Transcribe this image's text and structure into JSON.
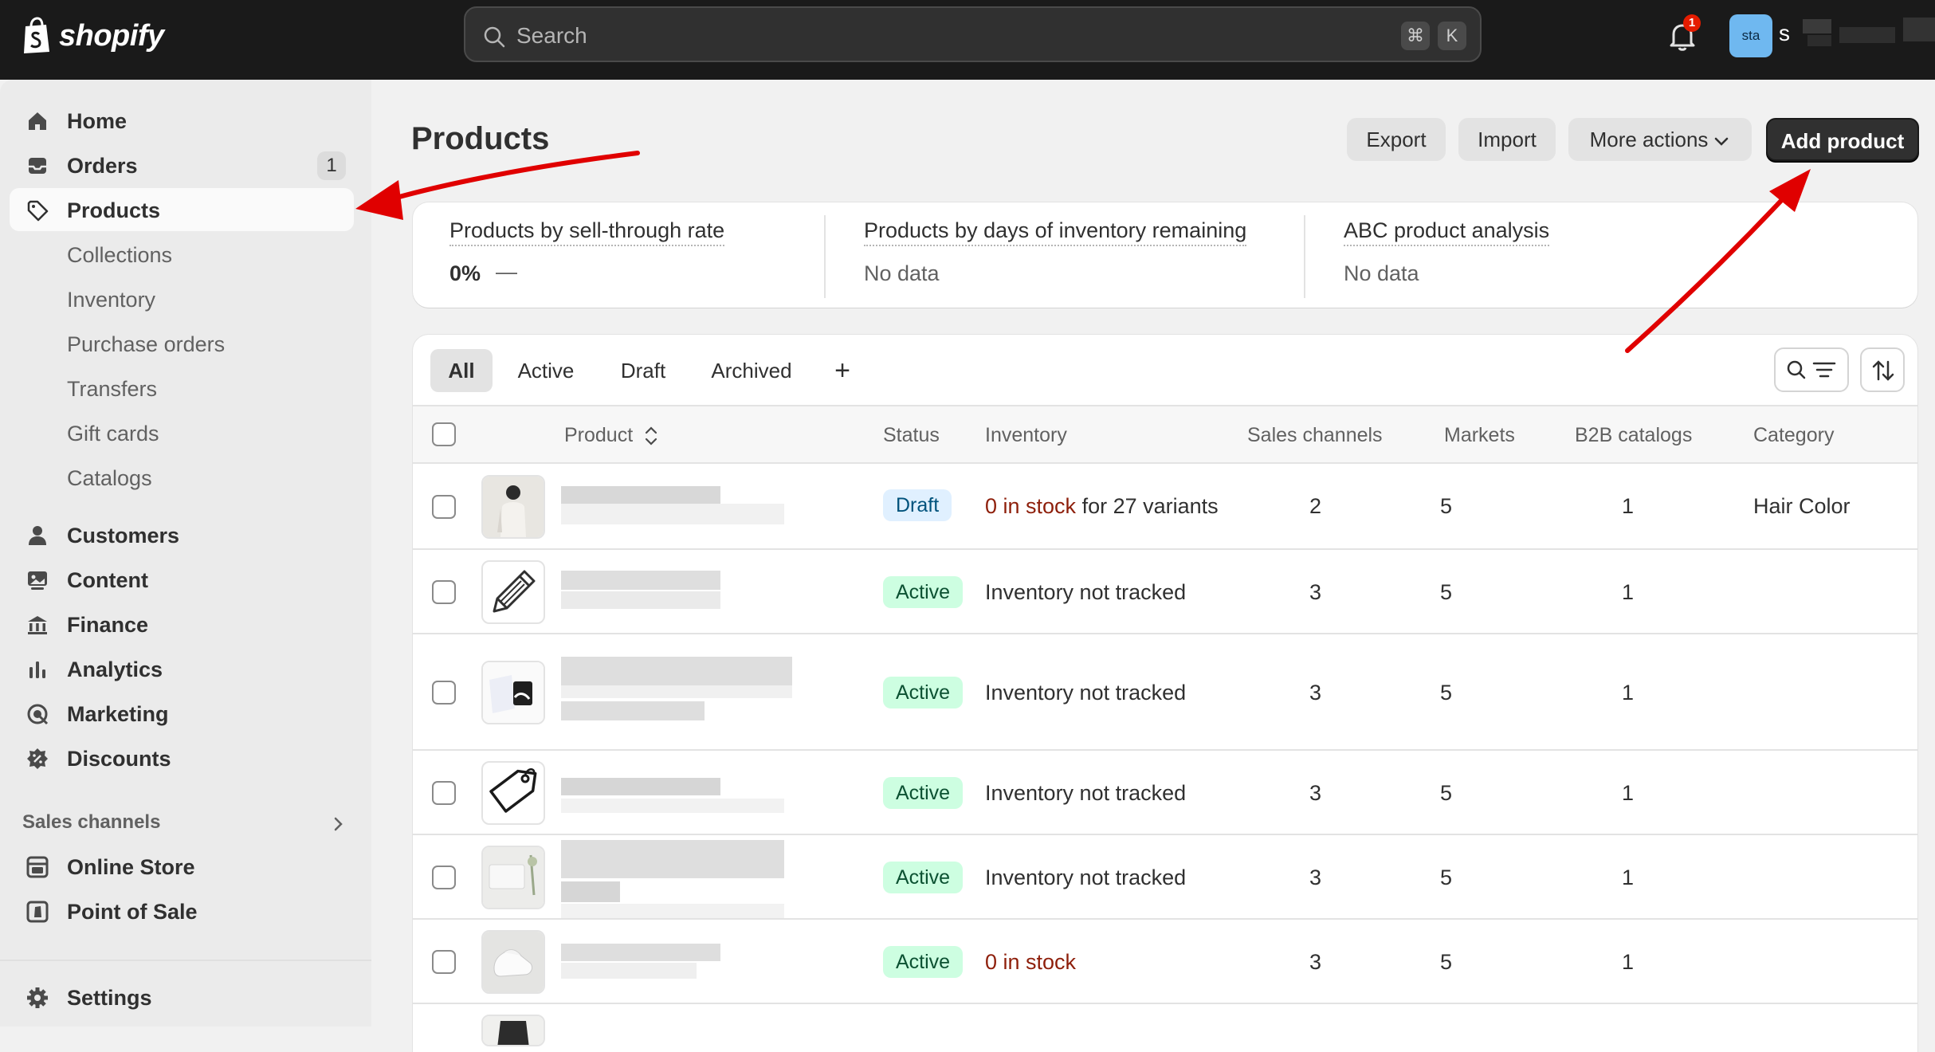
{
  "brand": {
    "name": "shopify",
    "color": "#1a1a1a",
    "accent": "#303030"
  },
  "search": {
    "placeholder": "Search",
    "shortcut_keys": [
      "⌘",
      "K"
    ]
  },
  "notifications": {
    "count": "1"
  },
  "account": {
    "avatar_initials": "sta",
    "store_name_visible": "s"
  },
  "sidebar": {
    "items": [
      {
        "label": "Home",
        "icon": "home-icon"
      },
      {
        "label": "Orders",
        "icon": "inbox-icon",
        "count": "1"
      },
      {
        "label": "Products",
        "icon": "tag-icon",
        "selected": true
      },
      {
        "label": "Collections"
      },
      {
        "label": "Inventory"
      },
      {
        "label": "Purchase orders"
      },
      {
        "label": "Transfers"
      },
      {
        "label": "Gift cards"
      },
      {
        "label": "Catalogs"
      },
      {
        "label": "Customers",
        "icon": "person-icon"
      },
      {
        "label": "Content",
        "icon": "image-icon"
      },
      {
        "label": "Finance",
        "icon": "bank-icon"
      },
      {
        "label": "Analytics",
        "icon": "bar-chart-icon"
      },
      {
        "label": "Marketing",
        "icon": "target-icon"
      },
      {
        "label": "Discounts",
        "icon": "discount-icon"
      }
    ],
    "sales_channels_title": "Sales channels",
    "channels": [
      {
        "label": "Online Store",
        "icon": "store-icon"
      },
      {
        "label": "Point of Sale",
        "icon": "pos-icon"
      }
    ],
    "settings_label": "Settings"
  },
  "page": {
    "title": "Products",
    "buttons": {
      "export": "Export",
      "import": "Import",
      "more_actions": "More actions",
      "add_product": "Add product"
    }
  },
  "metrics": [
    {
      "title": "Products by sell-through rate",
      "value": "0%",
      "trend": "—"
    },
    {
      "title": "Products by days of inventory remaining",
      "value": "No data"
    },
    {
      "title": "ABC product analysis",
      "value": "No data"
    }
  ],
  "tabs": [
    "All",
    "Active",
    "Draft",
    "Archived"
  ],
  "add_view_symbol": "+",
  "table": {
    "columns": [
      "Product",
      "Status",
      "Inventory",
      "Sales channels",
      "Markets",
      "B2B catalogs",
      "Category"
    ],
    "rows": [
      {
        "status": "Draft",
        "inventory_red": "0 in stock",
        "inventory_rest": " for 27 variants",
        "sales_channels": "2",
        "markets": "5",
        "b2b": "1",
        "category": "Hair Color"
      },
      {
        "status": "Active",
        "inventory_red": "",
        "inventory_rest": "Inventory not tracked",
        "sales_channels": "3",
        "markets": "5",
        "b2b": "1",
        "category": ""
      },
      {
        "status": "Active",
        "inventory_red": "",
        "inventory_rest": "Inventory not tracked",
        "sales_channels": "3",
        "markets": "5",
        "b2b": "1",
        "category": ""
      },
      {
        "status": "Active",
        "inventory_red": "",
        "inventory_rest": "Inventory not tracked",
        "sales_channels": "3",
        "markets": "5",
        "b2b": "1",
        "category": ""
      },
      {
        "status": "Active",
        "inventory_red": "",
        "inventory_rest": "Inventory not tracked",
        "sales_channels": "3",
        "markets": "5",
        "b2b": "1",
        "category": ""
      },
      {
        "status": "Active",
        "inventory_red": "0 in stock",
        "inventory_rest": "",
        "sales_channels": "3",
        "markets": "5",
        "b2b": "1",
        "category": ""
      }
    ]
  },
  "colors": {
    "draft_badge": "#e0f0ff",
    "active_badge": "#cdfee1",
    "stock_warning": "#8e1f0b",
    "annotation_arrow": "#e00000"
  }
}
